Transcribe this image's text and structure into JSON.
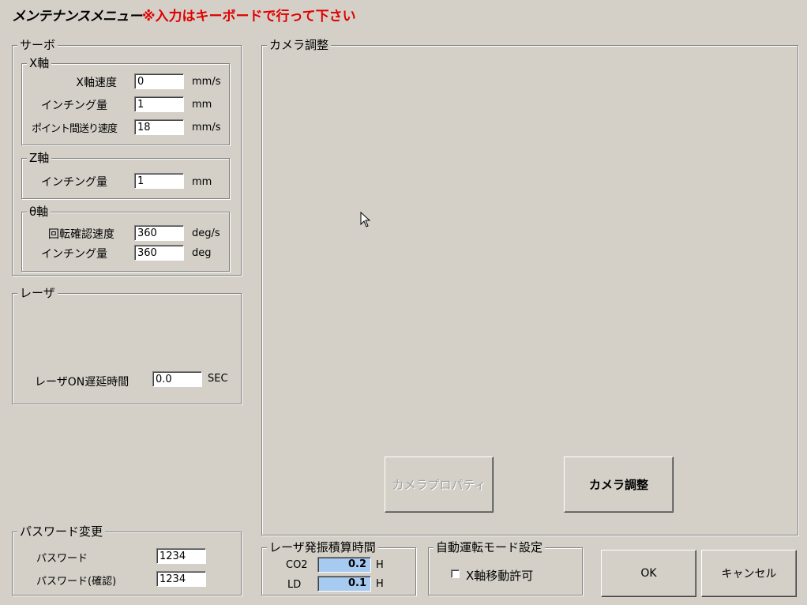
{
  "header": {
    "title": "メンテナンスメニュー",
    "notice": "※入力はキーボードで行って下さい"
  },
  "servo": {
    "label": "サーボ",
    "x_axis": {
      "label": "X軸",
      "speed_label": "X軸速度",
      "speed_value": "0",
      "speed_unit": "mm/s",
      "inching_label": "インチング量",
      "inching_value": "1",
      "inching_unit": "mm",
      "point_feed_label": "ポイント間送り速度",
      "point_feed_value": "18",
      "point_feed_unit": "mm/s"
    },
    "z_axis": {
      "label": "Z軸",
      "inching_label": "インチング量",
      "inching_value": "1",
      "inching_unit": "mm"
    },
    "theta_axis": {
      "label": "θ軸",
      "rotation_speed_label": "回転確認速度",
      "rotation_speed_value": "360",
      "rotation_speed_unit": "deg/s",
      "inching_label": "インチング量",
      "inching_value": "360",
      "inching_unit": "deg"
    }
  },
  "laser": {
    "label": "レーザ",
    "delay_label": "レーザON遅延時間",
    "delay_value": "0.0",
    "delay_unit": "SEC"
  },
  "password": {
    "label": "パスワード変更",
    "password_label": "パスワード",
    "password_value": "1234",
    "confirm_label": "パスワード(確認)",
    "confirm_value": "1234"
  },
  "camera": {
    "label": "カメラ調整",
    "properties_button": "カメラプロパティ",
    "adjust_button": "カメラ調整"
  },
  "laser_time": {
    "label": "レーザ発振積算時間",
    "co2_label": "CO2",
    "co2_value": "0.2",
    "co2_unit": "H",
    "ld_label": "LD",
    "ld_value": "0.1",
    "ld_unit": "H"
  },
  "auto_mode": {
    "label": "自動運転モード設定",
    "x_move_label": "X軸移動許可",
    "x_move_checked": false
  },
  "footer": {
    "ok_button": "OK",
    "cancel_button": "キャンセル"
  },
  "colors": {
    "background": "#d4d0c8",
    "notice": "#e00000",
    "readonly_field": "#a6caf0"
  }
}
